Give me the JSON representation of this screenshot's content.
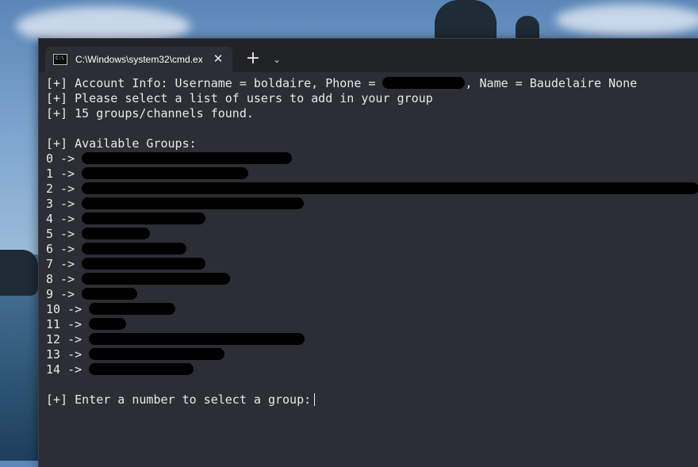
{
  "tab": {
    "title": "C:\\Windows\\system32\\cmd.exe",
    "icon": "cmd-icon",
    "icon_text": "C:\\"
  },
  "terminal": {
    "account_prefix": "[+] Account Info: Username = boldaire, Phone = ",
    "account_suffix": ", Name = Baudelaire None",
    "line2": "[+] Please select a list of users to add in your group",
    "line3": "[+] 15 groups/channels found.",
    "groups_header": "[+] Available Groups:",
    "groups": [
      {
        "label": "0 ->",
        "redact": 0.34
      },
      {
        "label": "1 ->",
        "redact": 0.27
      },
      {
        "label": "2 ->",
        "redact": 1.0
      },
      {
        "label": "3 ->",
        "redact": 0.36
      },
      {
        "label": "4 ->",
        "redact": 0.2
      },
      {
        "label": "5 ->",
        "redact": 0.11
      },
      {
        "label": "6 ->",
        "redact": 0.17
      },
      {
        "label": "7 ->",
        "redact": 0.2
      },
      {
        "label": "8 ->",
        "redact": 0.24
      },
      {
        "label": "9 ->",
        "redact": 0.09
      },
      {
        "label": "10 ->",
        "redact": 0.14
      },
      {
        "label": "11 ->",
        "redact": 0.06
      },
      {
        "label": "12 ->",
        "redact": 0.35
      },
      {
        "label": "13 ->",
        "redact": 0.22
      },
      {
        "label": "14 ->",
        "redact": 0.17
      }
    ],
    "prompt": "[+] Enter a number to select a group:"
  }
}
